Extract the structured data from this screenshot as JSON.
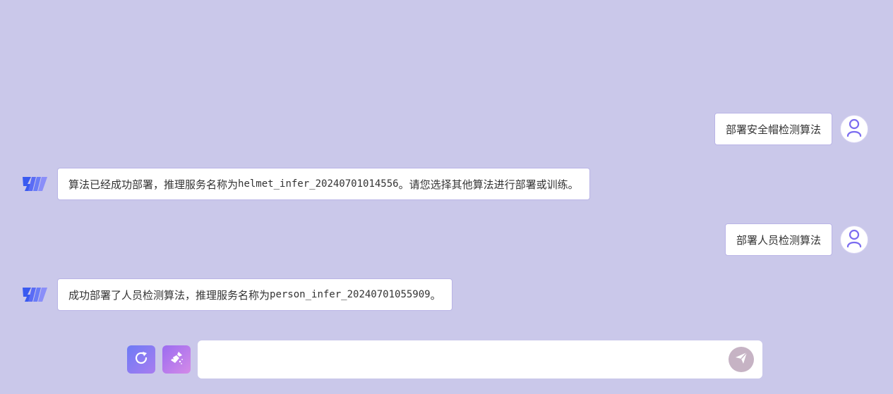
{
  "conversation": [
    {
      "role": "user",
      "text": "部署安全帽检测算法"
    },
    {
      "role": "bot",
      "prefix": "算法已经成功部署，推理服务名称为 ",
      "code": "helmet_infer_20240701014556",
      "suffix": "。请您选择其他算法进行部署或训练。"
    },
    {
      "role": "user",
      "text": "部署人员检测算法"
    },
    {
      "role": "bot",
      "prefix": "成功部署了人员检测算法，推理服务名称为",
      "code": "person_infer_20240701055909",
      "suffix": "。"
    }
  ],
  "composer": {
    "placeholder": "",
    "value": ""
  },
  "icons": {
    "user_avatar": "user-outline-icon",
    "bot_logo": "brand-logo-icon",
    "refresh": "refresh-icon",
    "clear": "broom-sparkle-icon",
    "send": "paper-plane-icon"
  },
  "colors": {
    "background": "#cac8ea",
    "bubble_border": "#b9b4e6",
    "accent": "#7b6cf0",
    "send_button": "#c6b3c4"
  }
}
